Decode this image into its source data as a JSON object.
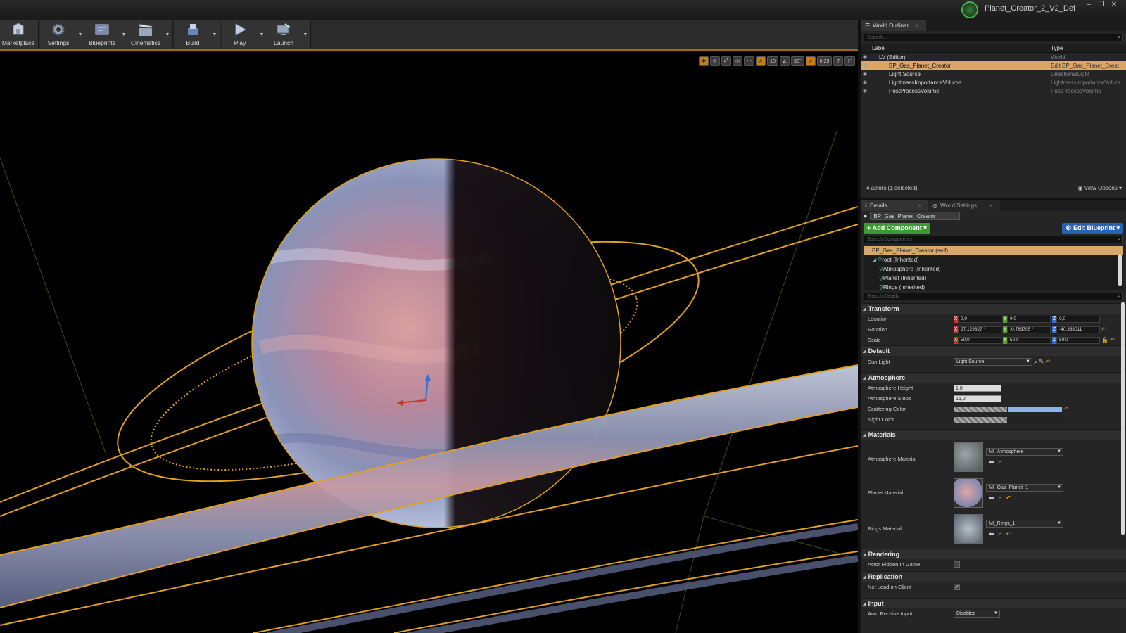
{
  "window": {
    "title": "Planet_Creator_2_V2_Def"
  },
  "toolbar": {
    "buttons": [
      {
        "label": "Marketplace",
        "icon": "marketplace-icon"
      },
      {
        "label": "Settings",
        "icon": "settings-icon"
      },
      {
        "label": "Blueprints",
        "icon": "blueprints-icon"
      },
      {
        "label": "Cinematics",
        "icon": "cinematics-icon"
      },
      {
        "label": "Build",
        "icon": "build-icon"
      },
      {
        "label": "Play",
        "icon": "play-icon"
      },
      {
        "label": "Launch",
        "icon": "launch-icon"
      }
    ]
  },
  "viewport": {
    "grid_snap": "10",
    "rotation_snap": "30°",
    "scale_snap": "0,25",
    "camera_speed": "7"
  },
  "outliner": {
    "tab": "World Outliner",
    "search_placeholder": "Search...",
    "col_label": "Label",
    "col_type": "Type",
    "rows": [
      {
        "label": "LV (Editor)",
        "type": "World"
      },
      {
        "label": "BP_Gas_Planet_Creator",
        "type": "Edit BP_Gas_Planet_Creat"
      },
      {
        "label": "Light Source",
        "type": "DirectionalLight"
      },
      {
        "label": "LightmassImportanceVolume",
        "type": "LightmassImportanceVolum"
      },
      {
        "label": "PostProcessVolume",
        "type": "PostProcessVolume"
      }
    ],
    "footer": "4 actors (1 selected)",
    "view_options": "View Options"
  },
  "details": {
    "tab": "Details",
    "tab2": "World Settings",
    "name": "BP_Gas_Planet_Creator",
    "add_component": "Add Component",
    "edit_blueprint": "Edit Blueprint",
    "search_components": "Search Components",
    "components": [
      "BP_Gas_Planet_Creator (self)",
      "root (Inherited)",
      "Atmosphere (Inherited)",
      "Planet (Inherited)",
      "Rings (Inherited)"
    ],
    "search_details": "Search Details",
    "transform": {
      "title": "Transform",
      "location_label": "Location",
      "rotation_label": "Rotation",
      "scale_label": "Scale",
      "location": [
        "0,0",
        "0,0",
        "0,0"
      ],
      "rotation": [
        "27,129627 °",
        "-0,789795 °",
        "-40,368011 °"
      ],
      "scale": [
        "50,0",
        "50,0",
        "50,0"
      ]
    },
    "default": {
      "title": "Default",
      "sun_light_label": "Sun Light",
      "sun_light_value": "Light Source"
    },
    "atmosphere": {
      "title": "Atmosphere",
      "height_label": "Atmosphere Height",
      "height_value": "1,0",
      "steps_label": "Atmosphere Steps",
      "steps_value": "16,0",
      "scattering_label": "Scattering Color",
      "night_label": "Night Color"
    },
    "materials": {
      "title": "Materials",
      "items": [
        {
          "label": "Atmosphere Material",
          "value": "MI_Atmosphere"
        },
        {
          "label": "Planet Material",
          "value": "MI_Gas_Planet_1"
        },
        {
          "label": "Rings Material",
          "value": "MI_Rings_1"
        }
      ]
    },
    "rendering": {
      "title": "Rendering",
      "hidden_label": "Actor Hidden In Game"
    },
    "replication": {
      "title": "Replication",
      "net_load_label": "Net Load on Client"
    },
    "input": {
      "title": "Input",
      "auto_receive_label": "Auto Receive Input",
      "auto_receive_value": "Disabled"
    }
  }
}
